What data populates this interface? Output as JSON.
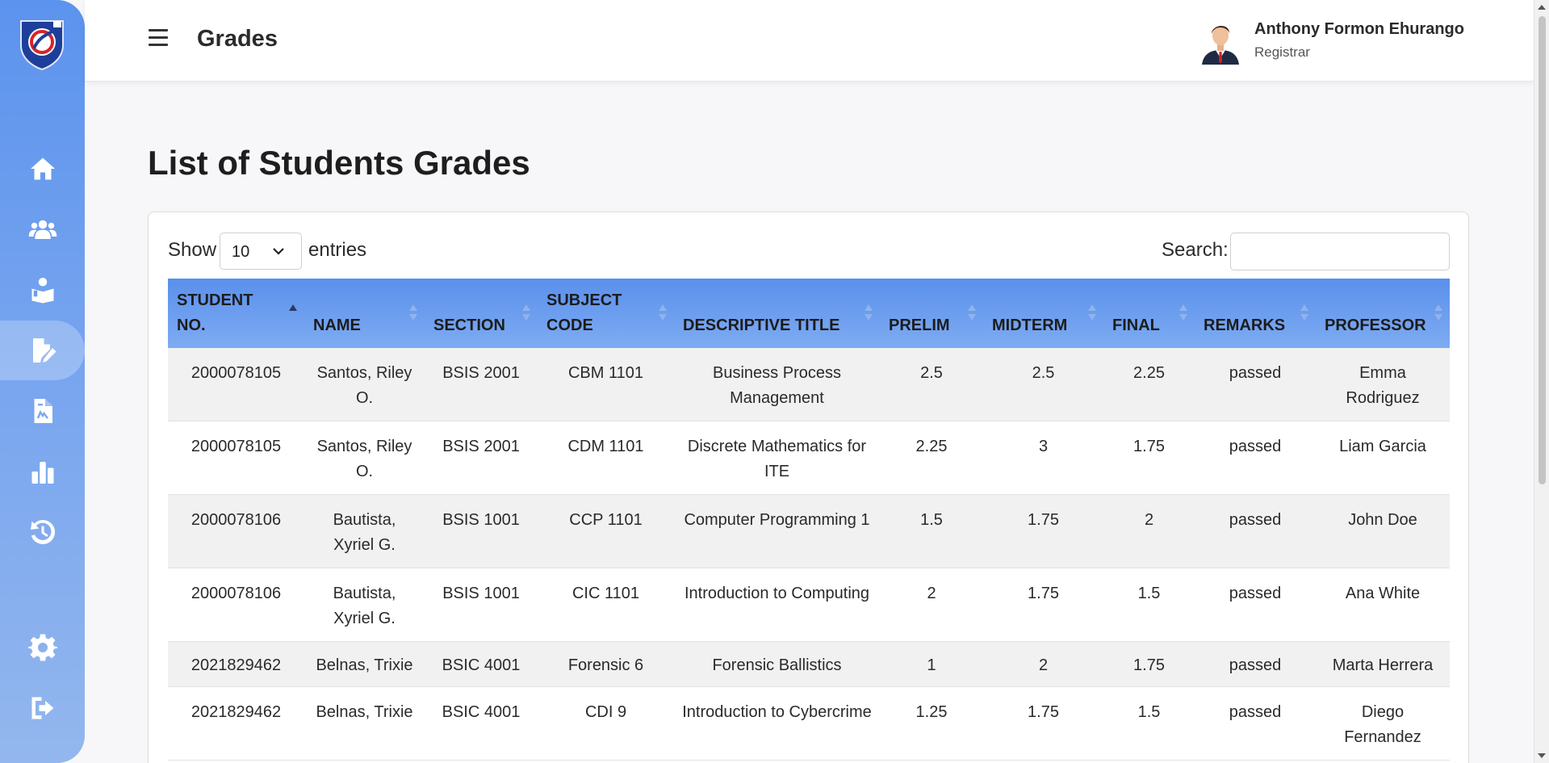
{
  "header": {
    "title": "Grades",
    "user_name": "Anthony Formon Ehurango",
    "user_role": "Registrar"
  },
  "sidebar": {
    "items": [
      {
        "icon": "home-icon",
        "active": false
      },
      {
        "icon": "users-icon",
        "active": false
      },
      {
        "icon": "student-icon",
        "active": false
      },
      {
        "icon": "grades-edit-icon",
        "active": true
      },
      {
        "icon": "report-file-icon",
        "active": false
      },
      {
        "icon": "bar-chart-icon",
        "active": false
      },
      {
        "icon": "history-icon",
        "active": false
      },
      {
        "icon": "gear-icon",
        "active": false
      },
      {
        "icon": "logout-icon",
        "active": false
      }
    ]
  },
  "main": {
    "heading": "List of Students Grades",
    "show_label": "Show",
    "entries_value": "10",
    "entries_label": "entries",
    "search_label": "Search:",
    "search_value": ""
  },
  "table": {
    "columns": [
      "STUDENT NO.",
      "NAME",
      "SECTION",
      "SUBJECT CODE",
      "DESCRIPTIVE TITLE",
      "PRELIM",
      "MIDTERM",
      "FINAL",
      "REMARKS",
      "PROFESSOR"
    ],
    "rows": [
      [
        "2000078105",
        "Santos, Riley O.",
        "BSIS 2001",
        "CBM 1101",
        "Business Process Management",
        "2.5",
        "2.5",
        "2.25",
        "passed",
        "Emma Rodriguez"
      ],
      [
        "2000078105",
        "Santos, Riley O.",
        "BSIS 2001",
        "CDM 1101",
        "Discrete Mathematics for ITE",
        "2.25",
        "3",
        "1.75",
        "passed",
        "Liam Garcia"
      ],
      [
        "2000078106",
        "Bautista, Xyriel G.",
        "BSIS 1001",
        "CCP 1101",
        "Computer Programming 1",
        "1.5",
        "1.75",
        "2",
        "passed",
        "John Doe"
      ],
      [
        "2000078106",
        "Bautista, Xyriel G.",
        "BSIS 1001",
        "CIC 1101",
        "Introduction to Computing",
        "2",
        "1.75",
        "1.5",
        "passed",
        "Ana White"
      ],
      [
        "2021829462",
        "Belnas, Trixie",
        "BSIC 4001",
        "Forensic 6",
        "Forensic Ballistics",
        "1",
        "2",
        "1.75",
        "passed",
        "Marta Herrera"
      ],
      [
        "2021829462",
        "Belnas, Trixie",
        "BSIC 4001",
        "CDI 9",
        "Introduction to Cybercrime",
        "1.25",
        "1.75",
        "1.5",
        "passed",
        "Diego Fernandez"
      ]
    ]
  },
  "colors": {
    "sidebar_top": "#5c93ee",
    "sidebar_bottom": "#93b7ee",
    "table_header": "#6a9cef",
    "row_alt": "#f1f1f1"
  }
}
